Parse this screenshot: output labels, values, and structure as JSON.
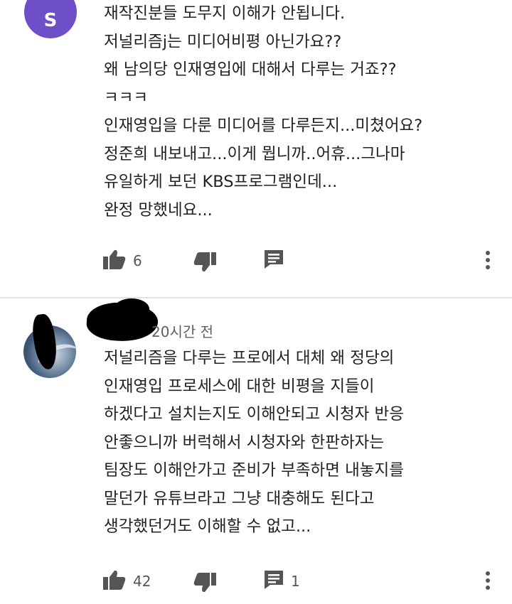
{
  "comments": [
    {
      "avatar_letter": "S",
      "avatar_color": "#6f4fc8",
      "lines": [
        "재작진분들 도무지 이해가 안됩니다.",
        "저널리즘j는 미디어비평 아닌가요??",
        "왜 남의당 인재영입에 대해서 다루는 거죠??",
        "ㅋㅋㅋ",
        "인재영입을 다룬 미디어를 다루든지...미쳤어요?",
        "정준희 내보내고...이게 뭡니까..어휴...그나마",
        "유일하게 보던 KBS프로그램인데...",
        "완정 망했네요..."
      ],
      "likes": "6",
      "replies": ""
    },
    {
      "timestamp": "20시간 전",
      "lines": [
        "저널리즘을 다루는 프로에서 대체 왜 정당의",
        "인재영입 프로세스에 대한 비평을 지들이",
        "하겠다고 설치는지도 이해안되고 시청자 반응",
        "안좋으니까 버럭해서 시청자와 한판하자는",
        "팀장도 이해안가고 준비가 부족하면 내놓지를",
        "말던가 유튜브라고 그냥 대충해도 된다고",
        "생각했던거도 이해할 수 없고..."
      ],
      "likes": "42",
      "replies": "1"
    }
  ],
  "icons": {
    "like": "thumbs-up-icon",
    "dislike": "thumbs-down-icon",
    "reply": "reply-icon",
    "more": "more-vert-icon"
  }
}
